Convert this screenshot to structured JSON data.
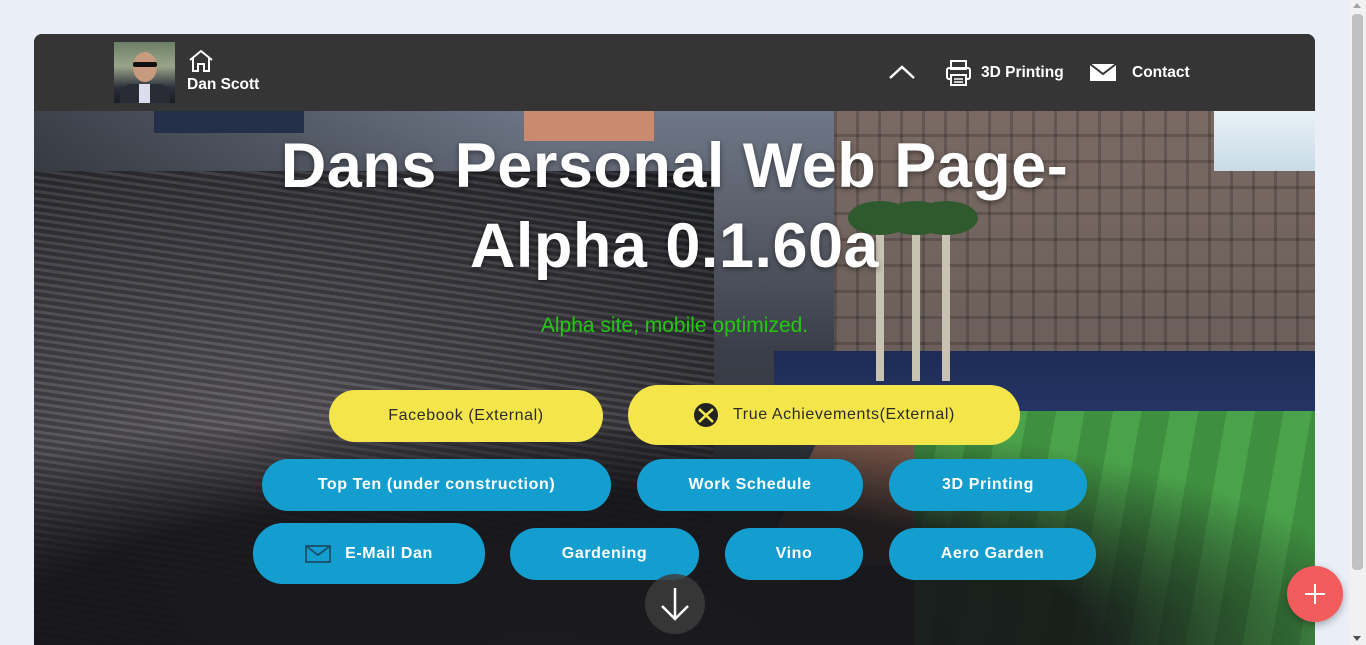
{
  "navbar": {
    "brand_name": "Dan Scott",
    "links": [
      {
        "label": "3D Printing",
        "icon": "printer-icon"
      },
      {
        "label": "Contact",
        "icon": "mail-icon"
      }
    ]
  },
  "hero": {
    "title_line1": "Dans Personal Web Page-",
    "title_line2": "Alpha 0.1.60a",
    "subtitle": "Alpha site, mobile optimized.",
    "buttons_row1": [
      {
        "label": "Facebook (External)",
        "color": "#f4e64a"
      },
      {
        "label": "True Achievements(External)",
        "icon": "xbox-icon",
        "color": "#f4e64a"
      }
    ],
    "buttons_row2": [
      {
        "label": "Top Ten (under construction)",
        "color": "#149ecf"
      },
      {
        "label": "Work Schedule",
        "color": "#149ecf"
      },
      {
        "label": "3D Printing",
        "color": "#149ecf"
      }
    ],
    "buttons_row3": [
      {
        "label": "E-Mail Dan",
        "icon": "mail-icon",
        "color": "#149ecf"
      },
      {
        "label": "Gardening",
        "color": "#149ecf"
      },
      {
        "label": "Vino",
        "color": "#149ecf"
      },
      {
        "label": "Aero Garden",
        "color": "#149ecf"
      }
    ]
  },
  "colors": {
    "navbar_bg": "#353535",
    "subtitle_green": "#22c90f",
    "fab_red": "#f25c5c"
  }
}
